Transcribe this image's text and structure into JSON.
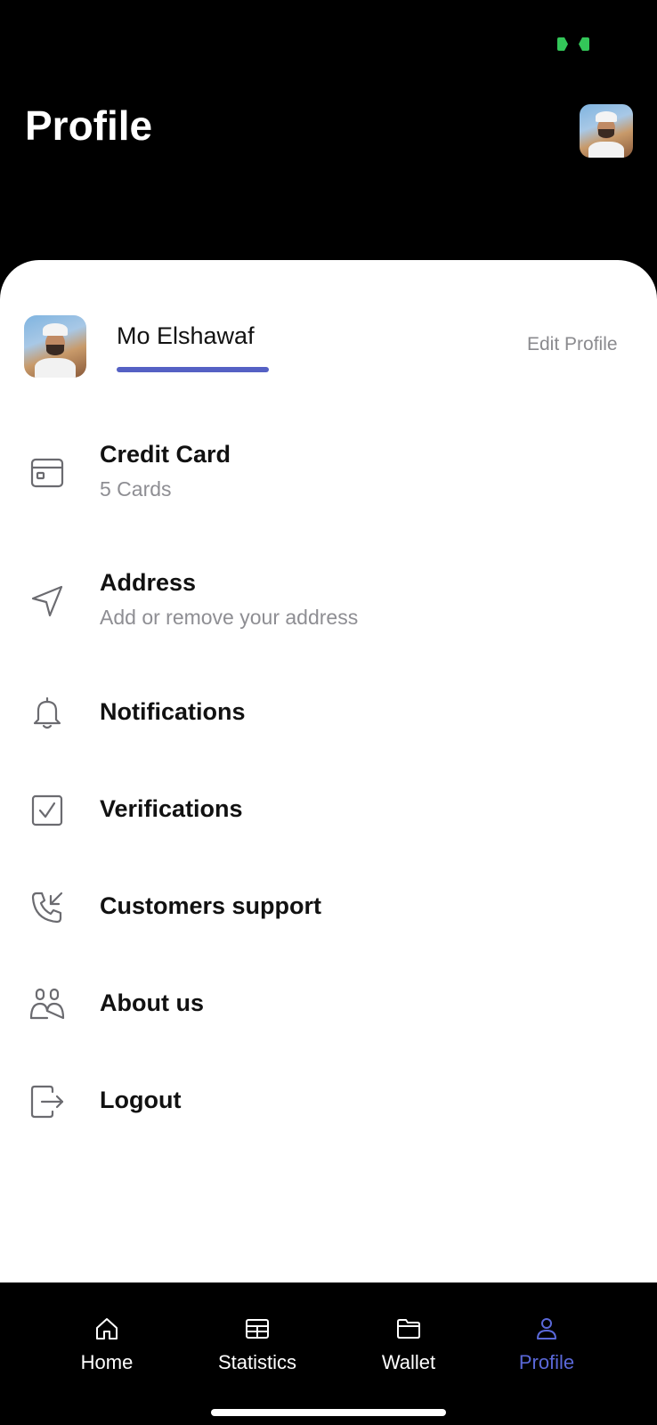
{
  "header": {
    "title": "Profile"
  },
  "colors": {
    "accent": "#5561c4",
    "battery": "#33c759",
    "background": "#000000"
  },
  "user": {
    "name": "Mo Elshawaf",
    "edit_label": "Edit Profile"
  },
  "menu": {
    "items": [
      {
        "title": "Credit Card",
        "subtitle": "5 Cards",
        "icon": "credit-card-icon"
      },
      {
        "title": "Address",
        "subtitle": "Add or remove your address",
        "icon": "navigation-icon"
      },
      {
        "title": "Notifications",
        "icon": "bell-icon"
      },
      {
        "title": "Verifications",
        "icon": "checkbox-icon"
      },
      {
        "title": "Customers support",
        "icon": "phone-incoming-icon"
      },
      {
        "title": "About us",
        "icon": "users-icon"
      },
      {
        "title": "Logout",
        "icon": "logout-icon"
      }
    ]
  },
  "tabbar": {
    "tabs": [
      {
        "label": "Home",
        "icon": "home-icon"
      },
      {
        "label": "Statistics",
        "icon": "table-icon"
      },
      {
        "label": "Wallet",
        "icon": "folder-icon"
      },
      {
        "label": "Profile",
        "icon": "user-icon",
        "active": true
      }
    ]
  }
}
